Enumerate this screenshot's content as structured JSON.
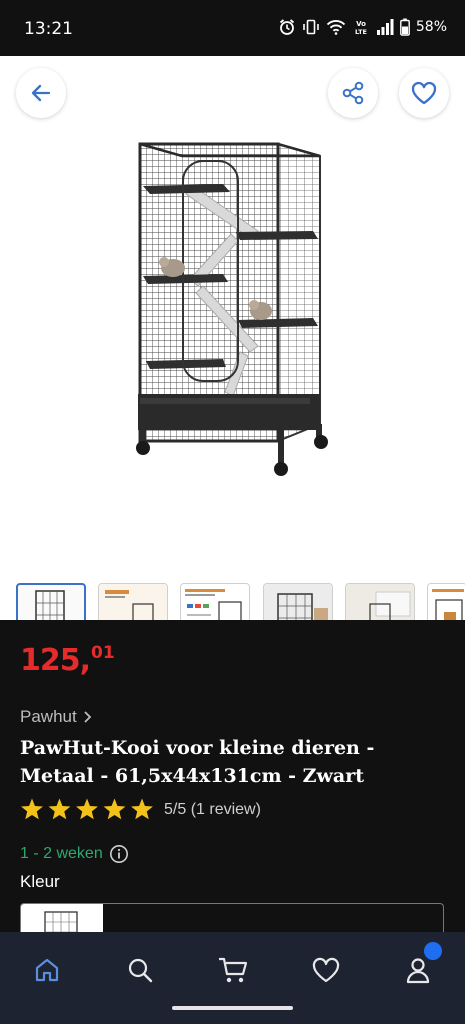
{
  "status_bar": {
    "time": "13:21",
    "battery": "58%"
  },
  "product": {
    "price_main": "125,",
    "price_cents": "01",
    "brand": "Pawhut",
    "title": "PawHut-Kooi voor kleine dieren - Metaal - 61,5x44x131cm - Zwart",
    "rating_value": 5,
    "rating_max": 5,
    "rating_text": "5/5 (1 review)",
    "delivery": "1 - 2 weken",
    "color_label": "Kleur"
  },
  "hero": {
    "back_icon": "arrow-left-icon",
    "share_icon": "share-icon",
    "favorite_icon": "heart-icon",
    "thumbnail_count": 6,
    "active_thumbnail": 0
  },
  "nav": {
    "items": [
      "home-icon",
      "search-icon",
      "cart-icon",
      "heart-icon",
      "account-icon"
    ],
    "active": "home-icon",
    "badge_color": "#1f6ef2"
  },
  "colors": {
    "price": "#e62b2b",
    "accent": "#3a72c7",
    "delivery": "#2ea86f",
    "star": "#f2c21b"
  }
}
